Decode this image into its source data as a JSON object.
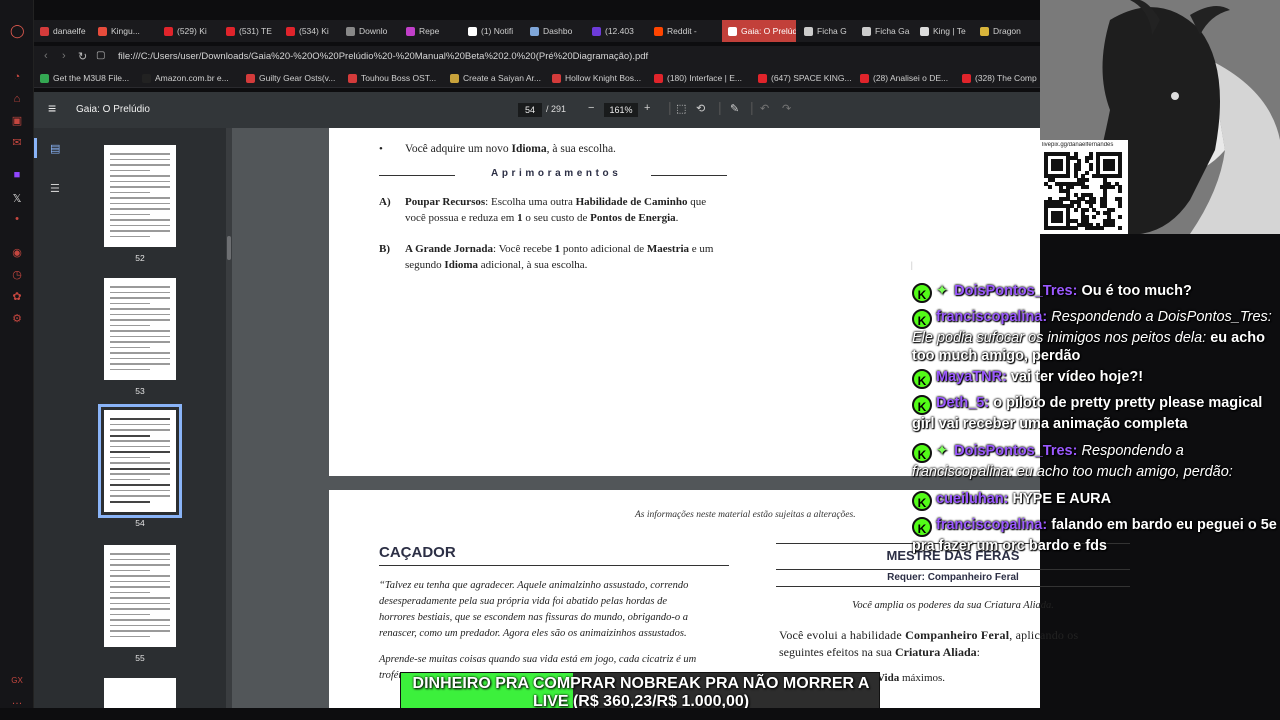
{
  "browser": {
    "tabs": [
      {
        "label": "danaelfe",
        "color": "#d43b3b"
      },
      {
        "label": "Kingu...",
        "color": "#e74c3c"
      },
      {
        "label": "(529) Ki",
        "color": "#e0242b"
      },
      {
        "label": "(531) TE",
        "color": "#e0242b"
      },
      {
        "label": "(534) Ki",
        "color": "#e0242b"
      },
      {
        "label": "Downlo",
        "color": "#888888"
      },
      {
        "label": "Repe",
        "color": "#c13fc9"
      },
      {
        "label": "(1) Notifi",
        "color": "#ffffff"
      },
      {
        "label": "Dashbo",
        "color": "#7fa6d9"
      },
      {
        "label": "(12.403",
        "color": "#6d3bd9"
      },
      {
        "label": "Reddit -",
        "color": "#ff4500"
      },
      {
        "label": "Gaia: O Prelúdio",
        "color": "#ffffff"
      },
      {
        "label": "Ficha G",
        "color": "#cccccc"
      },
      {
        "label": "Ficha Ga",
        "color": "#cccccc"
      },
      {
        "label": "King | Te",
        "color": "#dddddd"
      },
      {
        "label": "Dragon",
        "color": "#d9b53b"
      }
    ],
    "url": "file:///C:/Users/user/Downloads/Gaia%20-%20O%20Prelúdio%20-%20Manual%20Beta%202.0%20(Pré%20Diagramação).pdf",
    "bookmarks": [
      {
        "label": "Get the M3U8 File...",
        "color": "#34a853"
      },
      {
        "label": "Amazon.com.br e...",
        "color": "#222222"
      },
      {
        "label": "Guilty Gear Osts(v...",
        "color": "#d43b3b"
      },
      {
        "label": "Touhou Boss OST...",
        "color": "#d43b3b"
      },
      {
        "label": "Create a Saiyan Ar...",
        "color": "#c8a23b"
      },
      {
        "label": "Hollow Knight Bos...",
        "color": "#d43b3b"
      },
      {
        "label": "(180) Interface | E...",
        "color": "#e0242b"
      },
      {
        "label": "(647) SPACE KING...",
        "color": "#e0242b"
      },
      {
        "label": "(28) Analisei o DE...",
        "color": "#e0242b"
      },
      {
        "label": "(328) The Comp",
        "color": "#e0242b"
      }
    ]
  },
  "pdf": {
    "title": "Gaia: O Prelúdio",
    "page_current": "54",
    "page_total": "/ 291",
    "zoom": "161%",
    "thumb_pages": [
      "52",
      "53",
      "54",
      "55"
    ],
    "page1": {
      "bullet_pre": "Você adquire um novo ",
      "bullet_bold": "Idioma",
      "bullet_post": ", à sua escolha.",
      "heading": "Aprimoramentos",
      "a_label": "A)",
      "a_l1_b1": "Poupar Recursos",
      "a_l1_t1": ": Escolha uma outra ",
      "a_l1_b2": "Habilidade de Caminho",
      "a_l1_t2": " que",
      "a_l2_t1": "você possua e reduza em ",
      "a_l2_b1": "1",
      "a_l2_t2": " o seu custo de ",
      "a_l2_b2": "Pontos de Energia",
      "a_l2_t3": ".",
      "b_label": "B)",
      "b_l1_b1": "A Grande Jornada",
      "b_l1_t1": ": Você recebe ",
      "b_l1_b2": "1",
      "b_l1_t2": " ponto adicional de ",
      "b_l1_b3": "Maestria",
      "b_l1_t3": " e um",
      "b_l2_t1": "segundo ",
      "b_l2_b1": "Idioma",
      "b_l2_t2": " adicional, à sua escolha."
    },
    "page2": {
      "notice": "As informações neste material estão sujeitas a alterações.",
      "section": "CAÇADOR",
      "quote_lines": [
        "“Talvez eu tenha que agradecer. Aquele animalzinho assustado, correndo",
        "desesperadamente pela sua própria vida foi abatido pelas hordas de",
        "horrores bestiais, que se escondem nas fissuras do mundo, obrigando-o a",
        "renascer, como um predador. Agora eles são os animaizinhos assustados."
      ],
      "para2_l1": "Aprende-se muitas coisas quando sua vida está em jogo, cada cicatriz é um",
      "para2_l2": "troféu",
      "right_title": "MESTRE DAS FERAS",
      "right_req": "Requer: Companheiro Feral",
      "right_desc": "Você amplia os poderes da sua Criatura Aliada.",
      "r_l1_t1": "Você evolui a habilidade ",
      "r_l1_b1": "Companheiro Feral",
      "r_l1_t2": ", aplicando os",
      "r_l2_t1": "seguintes efeitos na sua ",
      "r_l2_b1": "Criatura Aliada",
      "r_l2_t2": ":",
      "r_l3_b1": "Vida",
      "r_l3_t1": " máximos."
    }
  },
  "stream": {
    "qr_caption": "livepix.gg/danaelfernandes",
    "chat": [
      {
        "user": "DoisPontos_Tres:",
        "text": " Ou é too much?",
        "gem": true
      },
      {
        "user": "franciscopalina:",
        "reply": " Respondendo a DoisPontos_Tres: Ele podia sufocar os inimigos nos peitos dela:",
        "text": " eu acho too much amigo, perdão"
      },
      {
        "user": "MayaTNR:",
        "text": " vai ter vídeo hoje?!"
      },
      {
        "user": "Deth_5:",
        "text": " o piloto de pretty pretty please magical girl vai receber uma animação completa"
      },
      {
        "user": "DoisPontos_Tres:",
        "reply": " Respondendo a franciscopalina: eu acho too much amigo, perdão:",
        "text": "",
        "gem": true
      },
      {
        "user": "cueiluhan:",
        "text": " HYPE E AURA"
      },
      {
        "user": "franciscopalina:",
        "text": " falando em bardo eu peguei o 5e pra fazer um orc bardo e fds"
      }
    ],
    "banner_text": "DINHEIRO PRA COMPRAR NOBREAK PRA NÃO MORRER A LIVE (R$ 360,23/R$ 1.000,00)",
    "banner_progress": 0.36,
    "banner_color": "#3cf03c"
  }
}
